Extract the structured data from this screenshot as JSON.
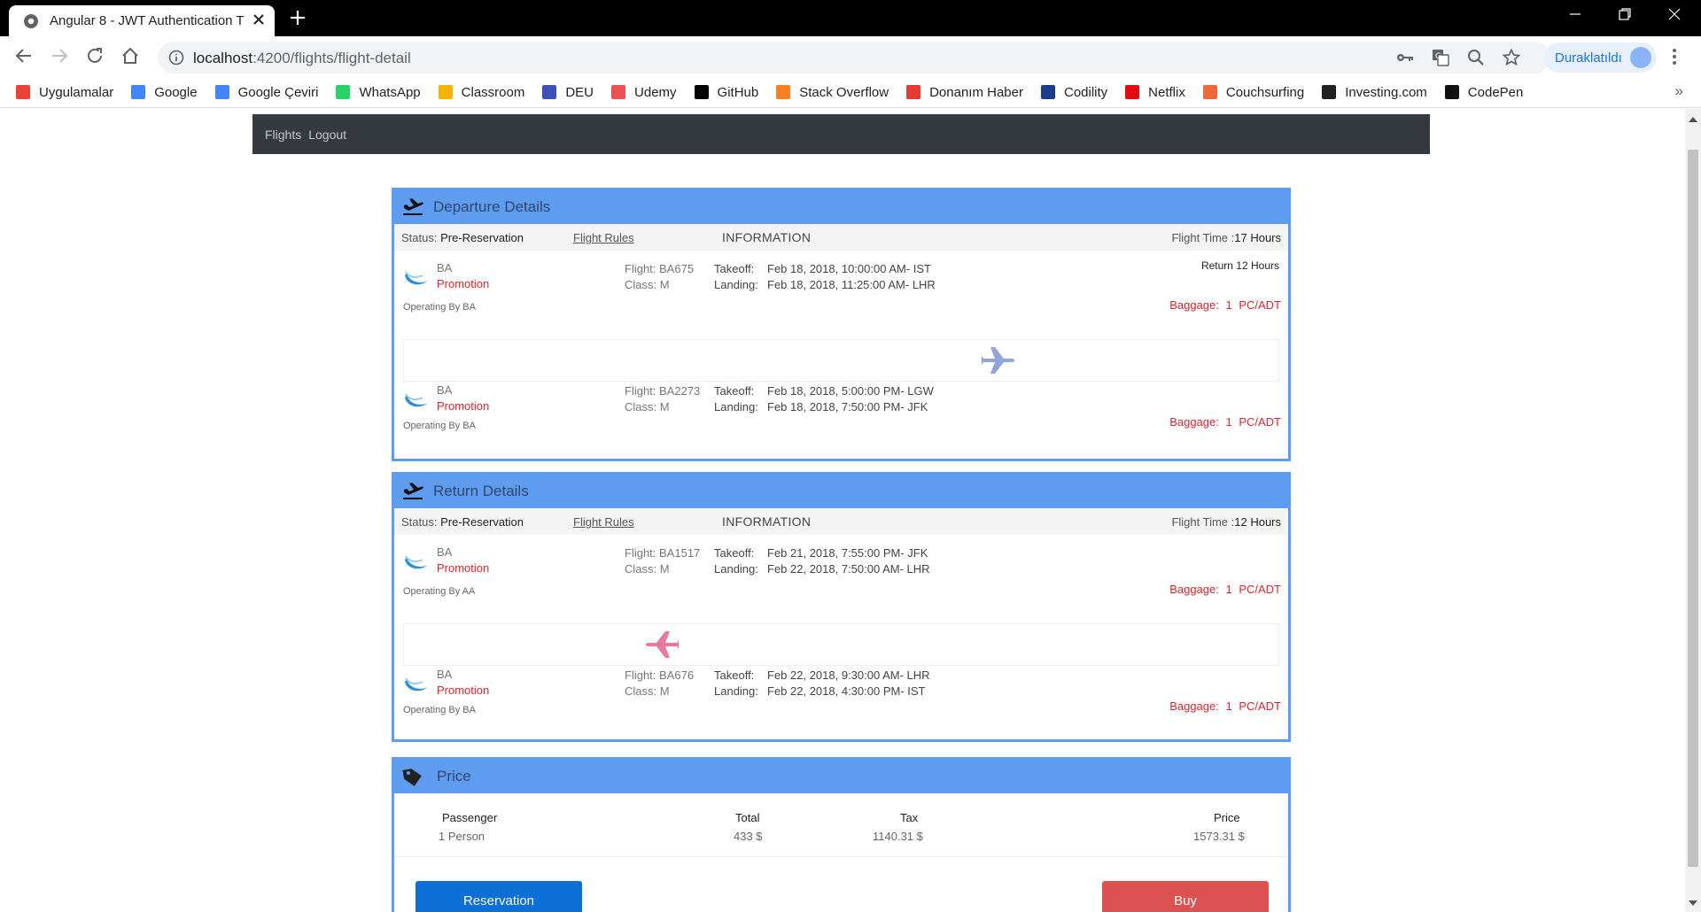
{
  "browser": {
    "tab_title": "Angular 8 - JWT Authentication T",
    "url_host": "localhost",
    "url_path": ":4200/flights/flight-detail",
    "profile_label": "Duraklatıldı",
    "bookmarks": [
      {
        "label": "Uygulamalar",
        "icon": "apps-grid-icon",
        "color": "#ea4335"
      },
      {
        "label": "Google",
        "icon": "google-icon",
        "color": "#4285f4"
      },
      {
        "label": "Google Çeviri",
        "icon": "translate-icon",
        "color": "#4285f4"
      },
      {
        "label": "WhatsApp",
        "icon": "whatsapp-icon",
        "color": "#25d366"
      },
      {
        "label": "Classroom",
        "icon": "classroom-icon",
        "color": "#f4b400"
      },
      {
        "label": "DEU",
        "icon": "deu-icon",
        "color": "#3f51b5"
      },
      {
        "label": "Udemy",
        "icon": "udemy-icon",
        "color": "#ec5252"
      },
      {
        "label": "GitHub",
        "icon": "github-icon",
        "color": "#000000"
      },
      {
        "label": "Stack Overflow",
        "icon": "stackoverflow-icon",
        "color": "#f48024"
      },
      {
        "label": "Donanım Haber",
        "icon": "dh-icon",
        "color": "#e53935"
      },
      {
        "label": "Codility",
        "icon": "codility-icon",
        "color": "#1e3a8a"
      },
      {
        "label": "Netflix",
        "icon": "netflix-icon",
        "color": "#e50914"
      },
      {
        "label": "Couchsurfing",
        "icon": "couchsurfing-icon",
        "color": "#ed6a3b"
      },
      {
        "label": "Investing.com",
        "icon": "investing-icon",
        "color": "#222222"
      },
      {
        "label": "CodePen",
        "icon": "codepen-icon",
        "color": "#111111"
      }
    ]
  },
  "nav": {
    "flights": "Flights",
    "logout": "Logout"
  },
  "departure": {
    "title": "Departure Details",
    "status_label": "Status:",
    "status_value": "Pre-Reservation",
    "rules": "Flight Rules",
    "information": "INFORMATION",
    "time_label": "Flight Time :",
    "time_value": "17 Hours",
    "legs": [
      {
        "airline": "BA",
        "fare": "Promotion",
        "operating": "Operating By BA",
        "flight": "Flight: BA675",
        "class": "Class: M",
        "takeoff_label": "Takeoff:",
        "landing_label": "Landing:",
        "takeoff": "Feb 18, 2018, 10:00:00 AM- IST",
        "landing": "Feb 18, 2018, 11:25:00 AM- LHR",
        "return_note": "Return 12 Hours",
        "baggage_label": "Baggage:",
        "baggage": "1 PC/ADT"
      },
      {
        "airline": "BA",
        "fare": "Promotion",
        "operating": "Operating By BA",
        "flight": "Flight: BA2273",
        "class": "Class: M",
        "takeoff_label": "Takeoff:",
        "landing_label": "Landing:",
        "takeoff": "Feb 18, 2018, 5:00:00 PM- LGW",
        "landing": "Feb 18, 2018, 7:50:00 PM- JFK",
        "baggage_label": "Baggage:",
        "baggage": "1 PC/ADT"
      }
    ]
  },
  "return": {
    "title": "Return Details",
    "status_label": "Status:",
    "status_value": "Pre-Reservation",
    "rules": "Flight Rules",
    "information": "INFORMATION",
    "time_label": "Flight Time :",
    "time_value": "12 Hours",
    "legs": [
      {
        "airline": "BA",
        "fare": "Promotion",
        "operating": "Operating By AA",
        "flight": "Flight: BA1517",
        "class": "Class: M",
        "takeoff_label": "Takeoff:",
        "landing_label": "Landing:",
        "takeoff": "Feb 21, 2018, 7:55:00 PM- JFK",
        "landing": "Feb 22, 2018, 7:50:00 AM- LHR",
        "baggage_label": "Baggage:",
        "baggage": "1 PC/ADT"
      },
      {
        "airline": "BA",
        "fare": "Promotion",
        "operating": "Operating By BA",
        "flight": "Flight: BA676",
        "class": "Class: M",
        "takeoff_label": "Takeoff:",
        "landing_label": "Landing:",
        "takeoff": "Feb 22, 2018, 9:30:00 AM- LHR",
        "landing": "Feb 22, 2018, 4:30:00 PM- IST",
        "baggage_label": "Baggage:",
        "baggage": "1 PC/ADT"
      }
    ]
  },
  "price": {
    "title": "Price",
    "headers": {
      "passenger": "Passenger",
      "total": "Total",
      "tax": "Tax",
      "price": "Price"
    },
    "values": {
      "passenger": "1 Person",
      "total": "433 $",
      "tax": "1140.31 $",
      "price": "1573.31 $"
    },
    "reservation_button": "Reservation",
    "buy_button": "Buy"
  },
  "colors": {
    "accent": "#5e9cf0",
    "promo_red": "#d9262f",
    "navbar": "#343a40",
    "departure_plane": "#8fa6d6",
    "return_plane": "#e8799c"
  }
}
